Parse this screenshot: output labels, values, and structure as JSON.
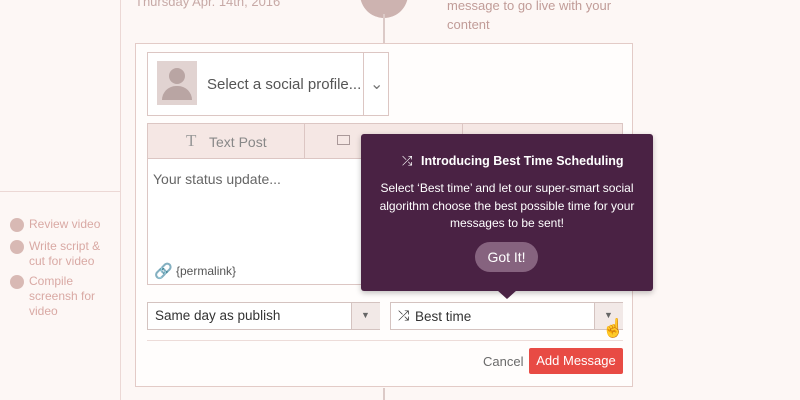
{
  "timeline": {
    "date": "Thursday Apr. 14th, 2016",
    "description": "message to go live with your content"
  },
  "tasks": [
    {
      "label": "Review video"
    },
    {
      "label": "Write script & cut for video"
    },
    {
      "label": "Compile screensh for video"
    }
  ],
  "composer": {
    "profile_placeholder": "Select a social profile...",
    "tabs": {
      "text_post_icon": "T",
      "text_post_label": "Text Post"
    },
    "status_placeholder": "Your status update...",
    "permalink": "{permalink}",
    "publish_select": "Same day as publish",
    "time_select": "Best time",
    "cancel_label": "Cancel",
    "add_label": "Add Message"
  },
  "tooltip": {
    "title": "Introducing Best Time Scheduling",
    "body": "Select ‘Best time’ and let our super-smart social algorithm choose the best possible time for your messages to be sent!",
    "button": "Got It!"
  },
  "icons": {
    "shuffle": "⤮",
    "link": "🔗",
    "chevron_down": "⌄",
    "triangle_down": "▼",
    "cursor": "☝"
  },
  "colors": {
    "accent": "#e84b44",
    "tooltip_bg": "#4a2244",
    "tooltip_button": "#86637f"
  }
}
